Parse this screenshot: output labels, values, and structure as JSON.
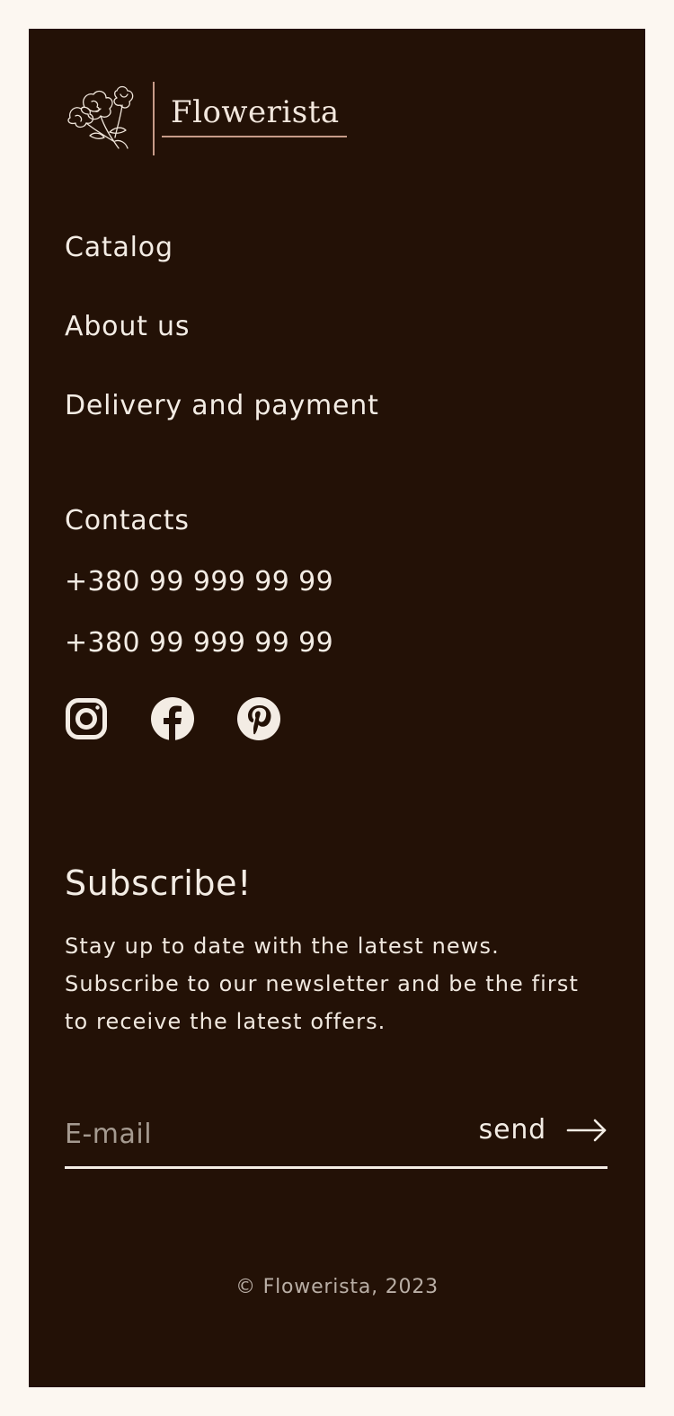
{
  "brand": {
    "name": "Flowerista",
    "logo_icon": "flower-sketch-icon",
    "accent_color": "#c79b88"
  },
  "nav": {
    "items": [
      {
        "label": "Catalog"
      },
      {
        "label": "About us"
      },
      {
        "label": "Delivery and payment"
      }
    ]
  },
  "contacts": {
    "title": "Contacts",
    "phones": [
      "+380 99 999 99 99",
      "+380 99 999 99 99"
    ]
  },
  "socials": {
    "icons": [
      "instagram-icon",
      "facebook-icon",
      "pinterest-icon"
    ]
  },
  "subscribe": {
    "title": "Subscribe!",
    "text": "Stay up to date with the latest news. Subscribe to our newsletter and be the first to receive the latest offers.",
    "email_placeholder": "E-mail",
    "email_value": "",
    "send_label": "send",
    "send_icon": "arrow-right-icon"
  },
  "footer": {
    "copyright": "© Flowerista, 2023",
    "background_color": "#231106",
    "page_color": "#fcf7f1"
  }
}
